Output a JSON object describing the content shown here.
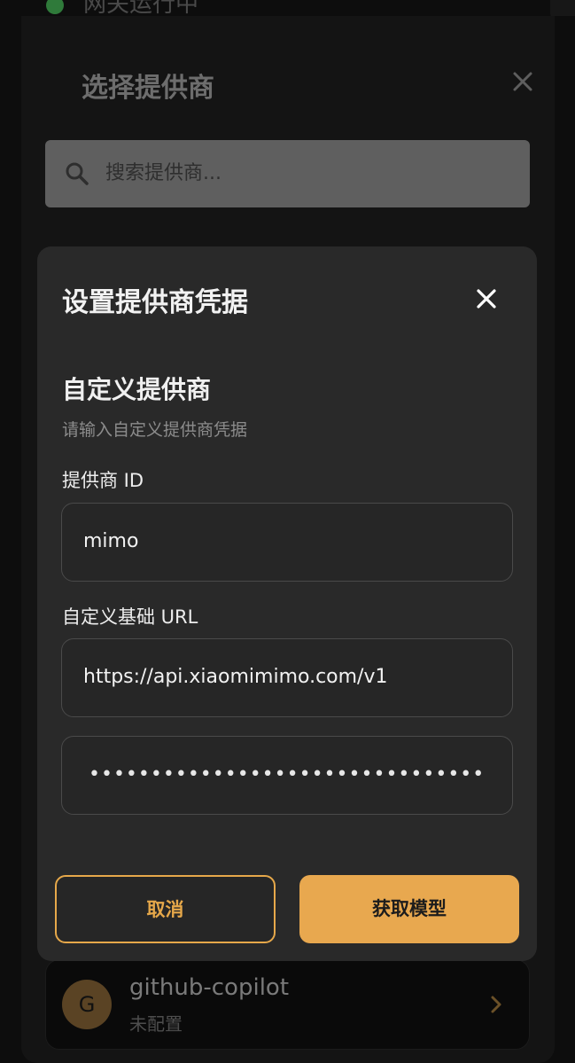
{
  "status": {
    "text": "网关运行中",
    "indicator_color": "#2f7a3a"
  },
  "picker": {
    "title": "选择提供商",
    "close_icon": "close-icon",
    "search": {
      "placeholder": "搜索提供商...",
      "icon": "search-icon"
    },
    "providers": [
      {
        "avatar_letter": "G",
        "name": "github-copilot",
        "status": "未配置",
        "icon": "chevron-right-icon"
      }
    ]
  },
  "dialog": {
    "title": "设置提供商凭据",
    "close_icon": "close-icon",
    "section_heading": "自定义提供商",
    "section_description": "请输入自定义提供商凭据",
    "fields": {
      "provider_id": {
        "label": "提供商 ID",
        "value": "mimo"
      },
      "base_url": {
        "label": "自定义基础 URL",
        "value": "https://api.xiaomimimo.com/v1"
      },
      "api_key": {
        "masked_value": "••••••••••••••••••••••••••••••••"
      }
    },
    "buttons": {
      "cancel": "取消",
      "fetch_models": "获取模型"
    },
    "accent_color": "#e8a84f"
  }
}
